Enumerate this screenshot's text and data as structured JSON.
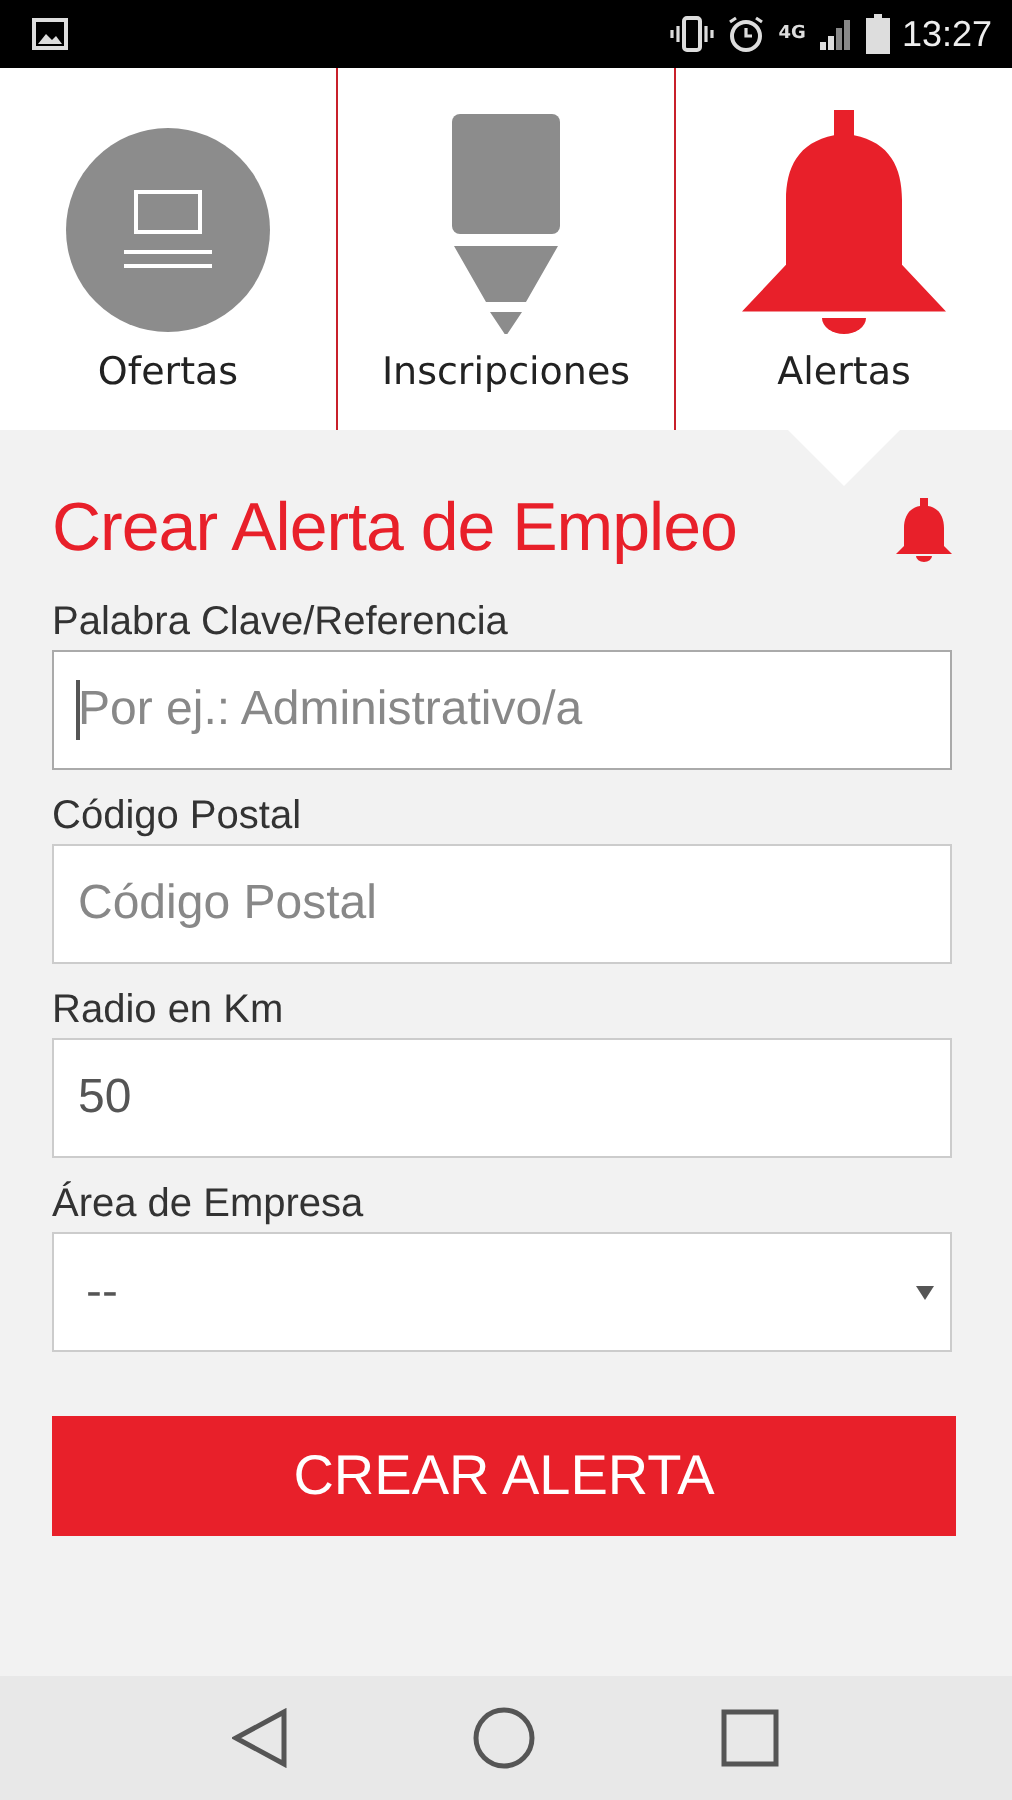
{
  "status_bar": {
    "time": "13:27",
    "network": "4G"
  },
  "tabs": [
    {
      "label": "Ofertas",
      "kind": "monitor",
      "selected": false
    },
    {
      "label": "Inscripciones",
      "kind": "pencil",
      "selected": false
    },
    {
      "label": "Alertas",
      "kind": "bell",
      "selected": true
    }
  ],
  "form": {
    "title": "Crear Alerta de Empleo",
    "fields": [
      {
        "kind": "text",
        "label": "Palabra Clave/Referencia",
        "placeholder": "Por ej.: Administrativo/a",
        "focused": true
      },
      {
        "kind": "text",
        "label": "Código Postal",
        "placeholder": "Código Postal",
        "focused": false
      },
      {
        "kind": "text",
        "label": "Radio en Km",
        "value": "50",
        "focused": false
      },
      {
        "kind": "select",
        "label": "Área de Empresa",
        "value": "--"
      }
    ],
    "submit": "CREAR ALERTA"
  }
}
